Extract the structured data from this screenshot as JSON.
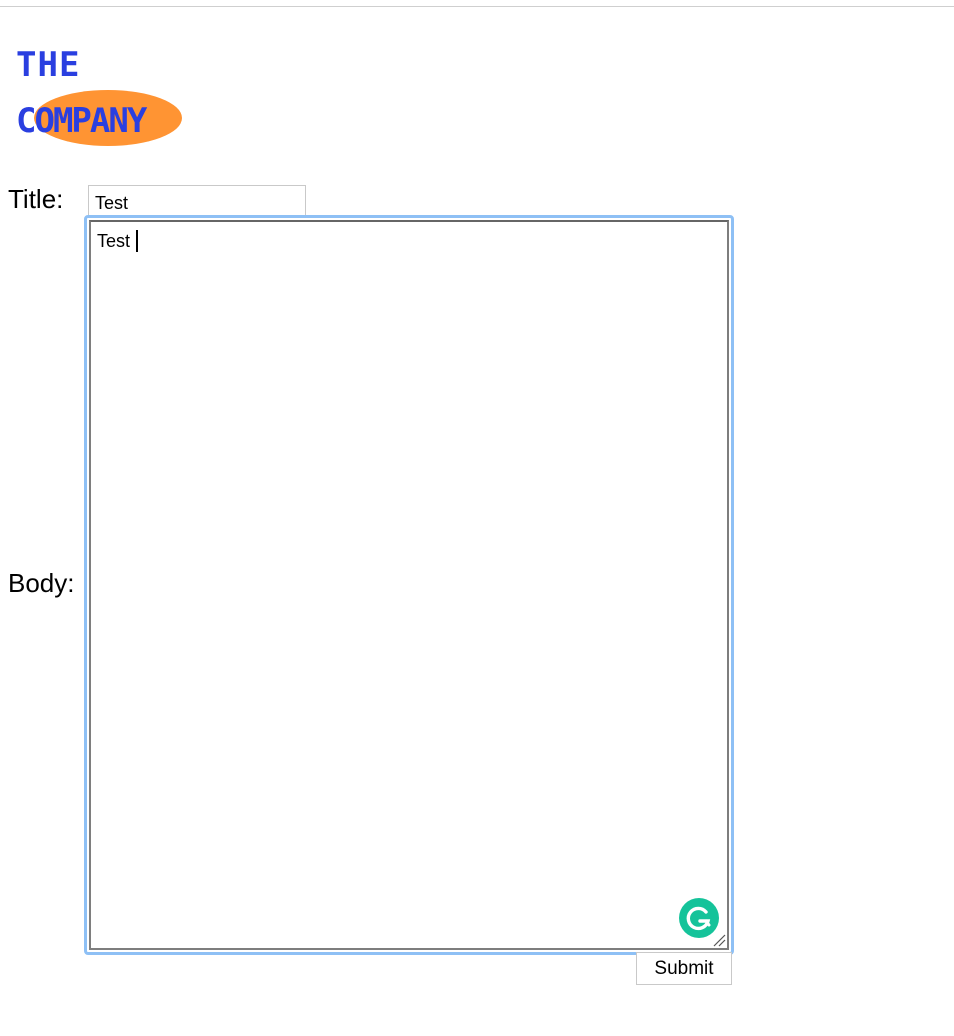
{
  "logo": {
    "line1": "THE",
    "line2": "COMPANY",
    "colors": {
      "text": "#2a3fe0",
      "ellipse": "#ff9433"
    }
  },
  "form": {
    "title_label": "Title:",
    "title_value": "Test",
    "body_label": "Body:",
    "body_value": "Test",
    "submit_label": "Submit"
  },
  "icons": {
    "grammarly": "grammarly-icon",
    "resize": "resize-handle-icon"
  },
  "colors": {
    "focus_ring": "#8ec0f5",
    "grammarly": "#15c39a"
  }
}
